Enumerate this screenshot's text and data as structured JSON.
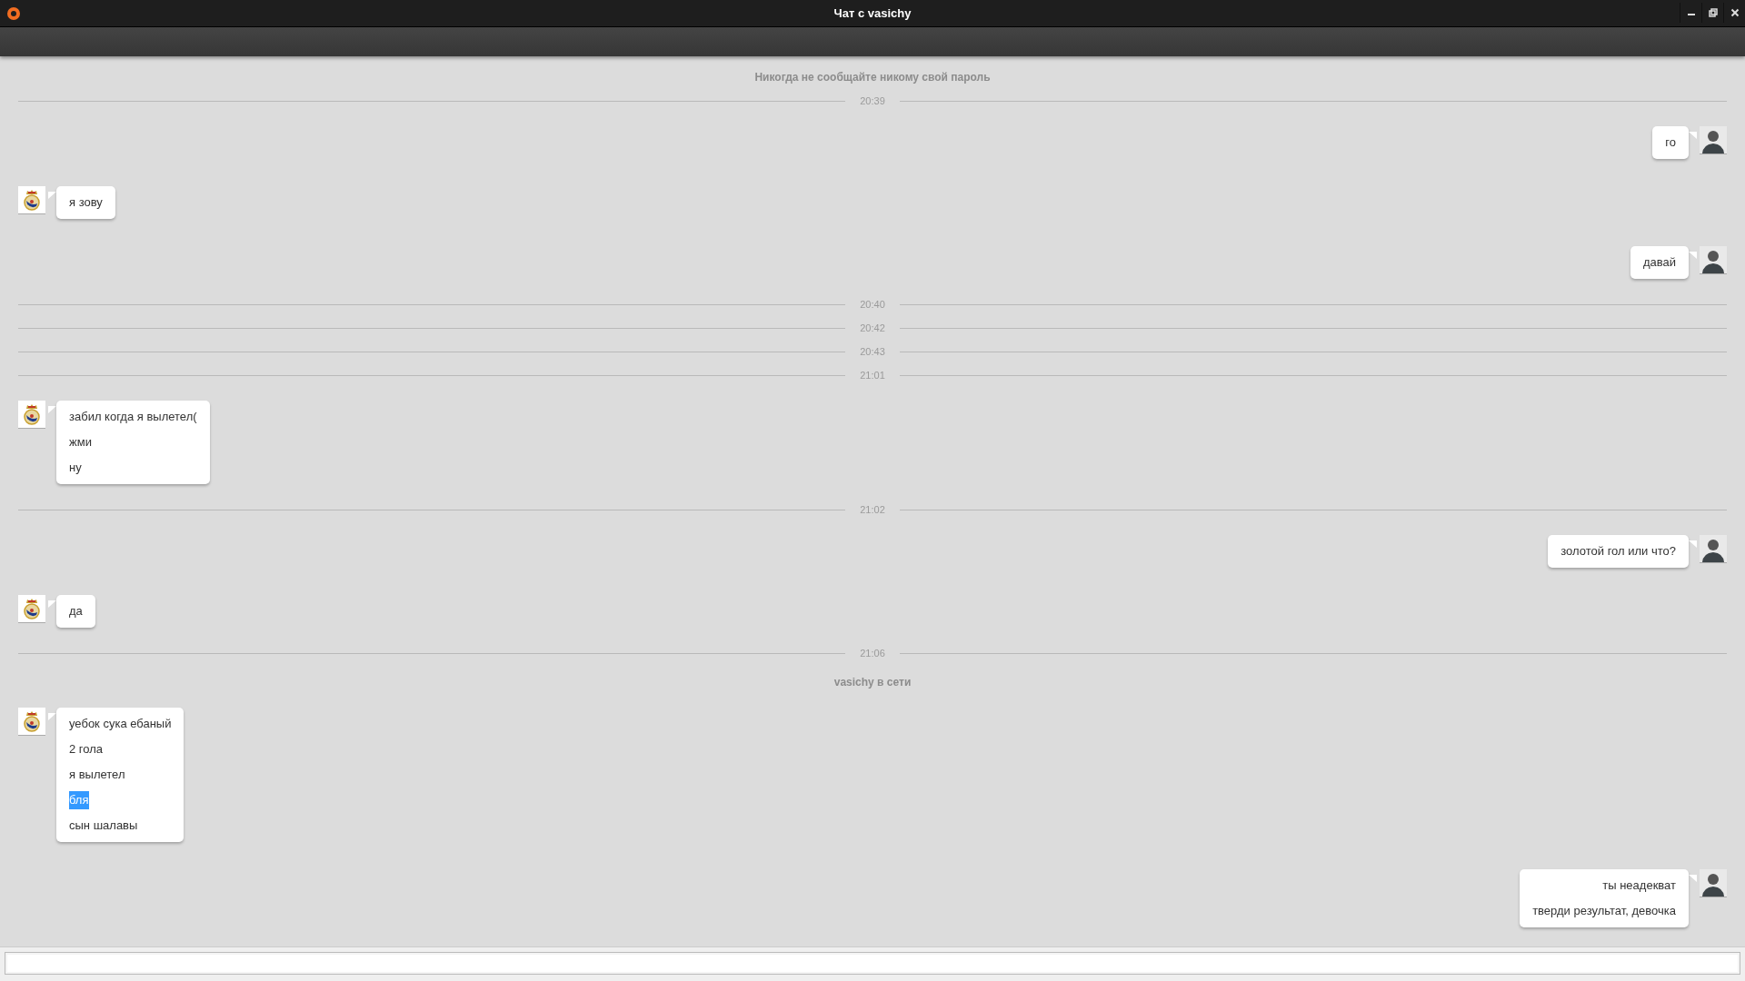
{
  "window": {
    "title": "Чат с vasichy"
  },
  "notice": "Никогда не сообщайте никому свой пароль",
  "items": [
    {
      "kind": "time",
      "text": "20:39"
    },
    {
      "kind": "outgoing",
      "lines": [
        {
          "text": "го",
          "highlighted": false
        }
      ]
    },
    {
      "kind": "incoming",
      "lines": [
        {
          "text": "я зову",
          "highlighted": false
        }
      ]
    },
    {
      "kind": "outgoing",
      "lines": [
        {
          "text": "давай",
          "highlighted": false
        }
      ]
    },
    {
      "kind": "time",
      "text": "20:40"
    },
    {
      "kind": "time",
      "text": "20:42"
    },
    {
      "kind": "time",
      "text": "20:43"
    },
    {
      "kind": "time",
      "text": "21:01"
    },
    {
      "kind": "incoming",
      "lines": [
        {
          "text": "забил когда я вылетел(",
          "highlighted": false
        },
        {
          "text": "жми",
          "highlighted": false
        },
        {
          "text": "ну",
          "highlighted": false
        }
      ]
    },
    {
      "kind": "time",
      "text": "21:02"
    },
    {
      "kind": "outgoing",
      "lines": [
        {
          "text": "золотой гол или что?",
          "highlighted": false
        }
      ]
    },
    {
      "kind": "incoming",
      "lines": [
        {
          "text": "да",
          "highlighted": false
        }
      ]
    },
    {
      "kind": "time",
      "text": "21:06"
    },
    {
      "kind": "status",
      "text": "vasichy в сети"
    },
    {
      "kind": "incoming",
      "lines": [
        {
          "text": "уебок сука ебаный",
          "highlighted": false
        },
        {
          "text": "2 гола",
          "highlighted": false
        },
        {
          "text": "я вылетел",
          "highlighted": false
        },
        {
          "text": "бля",
          "highlighted": true
        },
        {
          "text": "сын шалавы",
          "highlighted": false
        }
      ]
    },
    {
      "kind": "outgoing",
      "lines": [
        {
          "text": "ты неадекват",
          "highlighted": false
        },
        {
          "text": "тверди результат, девочка",
          "highlighted": false
        }
      ]
    }
  ]
}
